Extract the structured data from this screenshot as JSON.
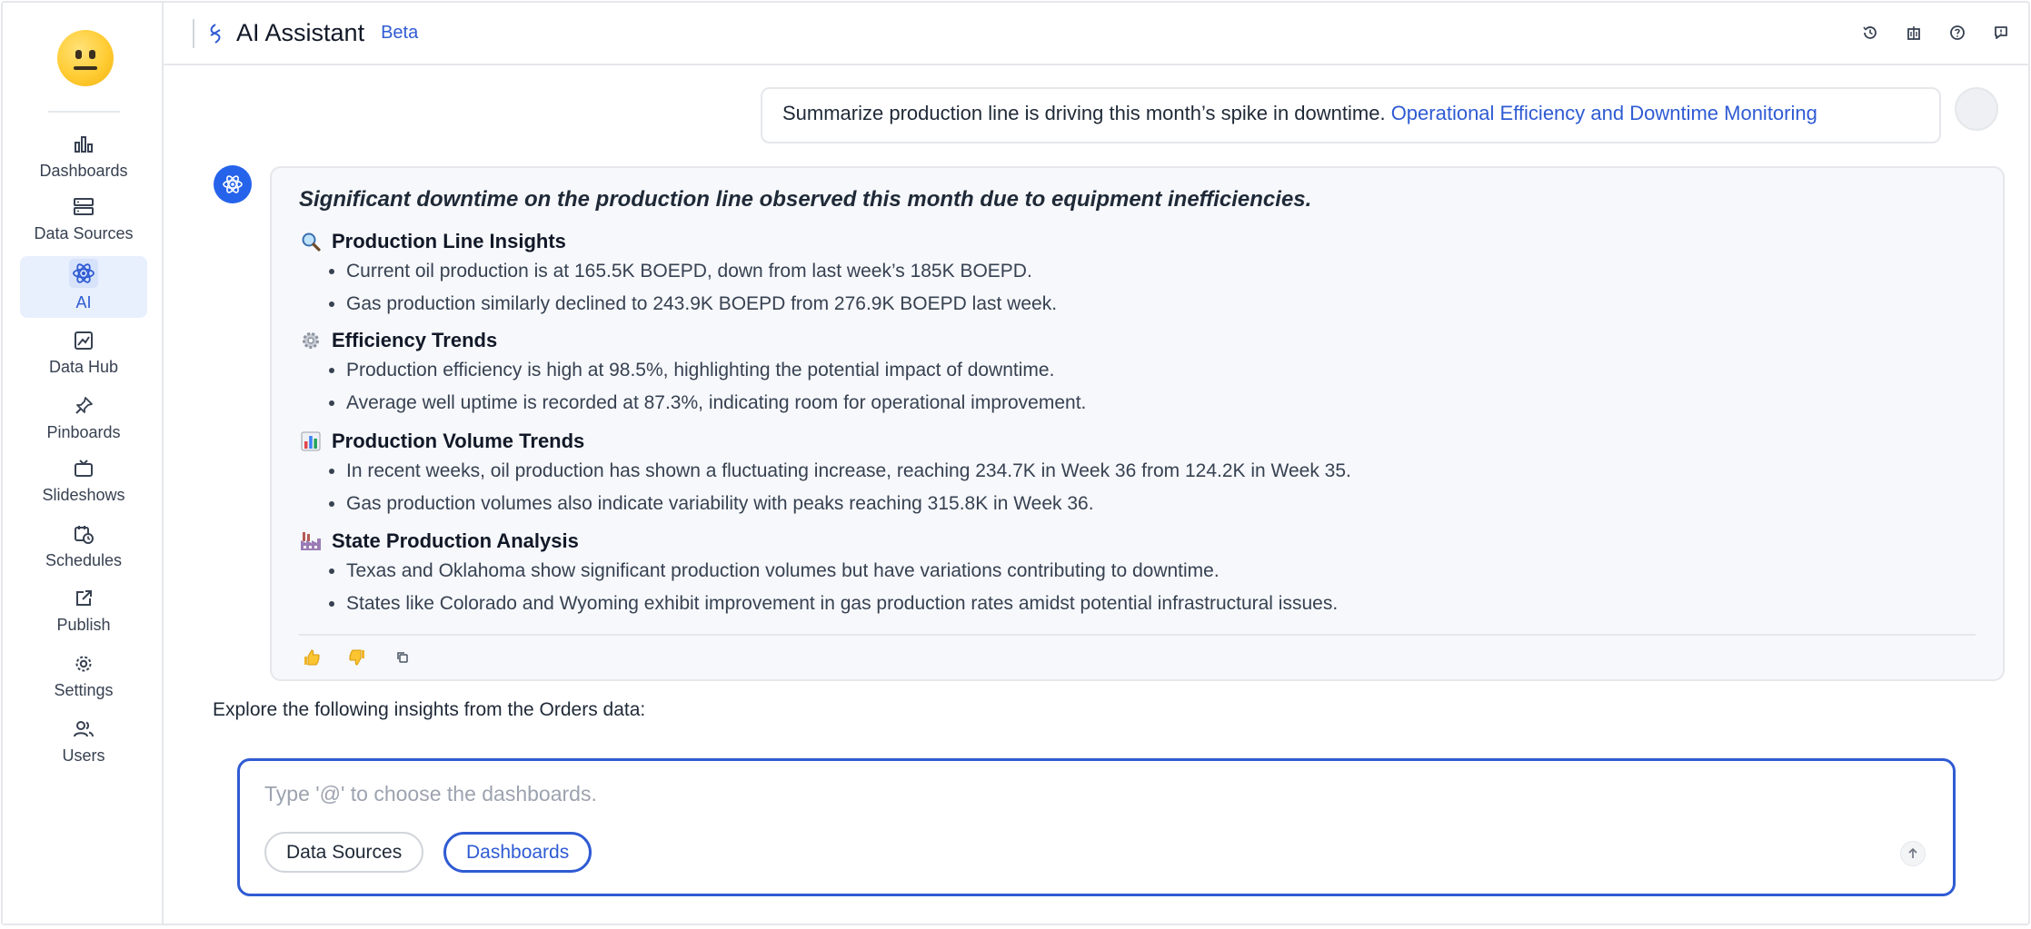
{
  "sidebar": {
    "items": [
      {
        "label": "Dashboards",
        "icon": "bar-chart-icon"
      },
      {
        "label": "Data Sources",
        "icon": "server-icon"
      },
      {
        "label": "AI",
        "icon": "atom-icon"
      },
      {
        "label": "Data Hub",
        "icon": "image-frame-icon"
      },
      {
        "label": "Pinboards",
        "icon": "pin-icon"
      },
      {
        "label": "Slideshows",
        "icon": "tv-icon"
      },
      {
        "label": "Schedules",
        "icon": "calendar-clock-icon"
      },
      {
        "label": "Publish",
        "icon": "share-icon"
      },
      {
        "label": "Settings",
        "icon": "gear-icon"
      },
      {
        "label": "Users",
        "icon": "users-icon"
      }
    ],
    "active": "AI",
    "accent_color": "#2f5bd3"
  },
  "header": {
    "title": "AI Assistant",
    "badge": "Beta"
  },
  "conversation": {
    "user_message": {
      "text": "Summarize production line is driving this month’s spike in downtime.",
      "link": "Operational Efficiency and Downtime Monitoring"
    },
    "answer": {
      "headline": "Significant downtime on the production line observed this month due to equipment inefficiencies.",
      "sections": [
        {
          "title": "Production Line Insights",
          "emoji": "magnifier-emoji",
          "bullets": [
            "Current oil production is at 165.5K BOEPD, down from last week’s 185K BOEPD.",
            "Gas production similarly declined to 243.9K BOEPD from 276.9K BOEPD last week."
          ]
        },
        {
          "title": "Efficiency Trends",
          "emoji": "gear-emoji",
          "bullets": [
            "Production efficiency is high at 98.5%, highlighting the potential impact of downtime.",
            "Average well uptime is recorded at 87.3%, indicating room for operational improvement."
          ]
        },
        {
          "title": "Production Volume Trends",
          "emoji": "bar-chart-emoji",
          "bullets": [
            "In recent weeks, oil production has shown a fluctuating increase, reaching 234.7K in Week 36 from 124.2K in Week 35.",
            "Gas production volumes also indicate variability with peaks reaching 315.8K in Week 36."
          ]
        },
        {
          "title": "State Production Analysis",
          "emoji": "factory-emoji",
          "bullets": [
            "Texas and Oklahoma show significant production volumes but have variations contributing to downtime.",
            "States like Colorado and Wyoming exhibit improvement in gas production rates amidst potential infrastructural issues."
          ]
        }
      ]
    },
    "explore_text": "Explore the following insights from the Orders data:"
  },
  "composer": {
    "placeholder": "Type '@' to choose the dashboards.",
    "value": "",
    "chips": [
      "Data Sources",
      "Dashboards"
    ]
  }
}
